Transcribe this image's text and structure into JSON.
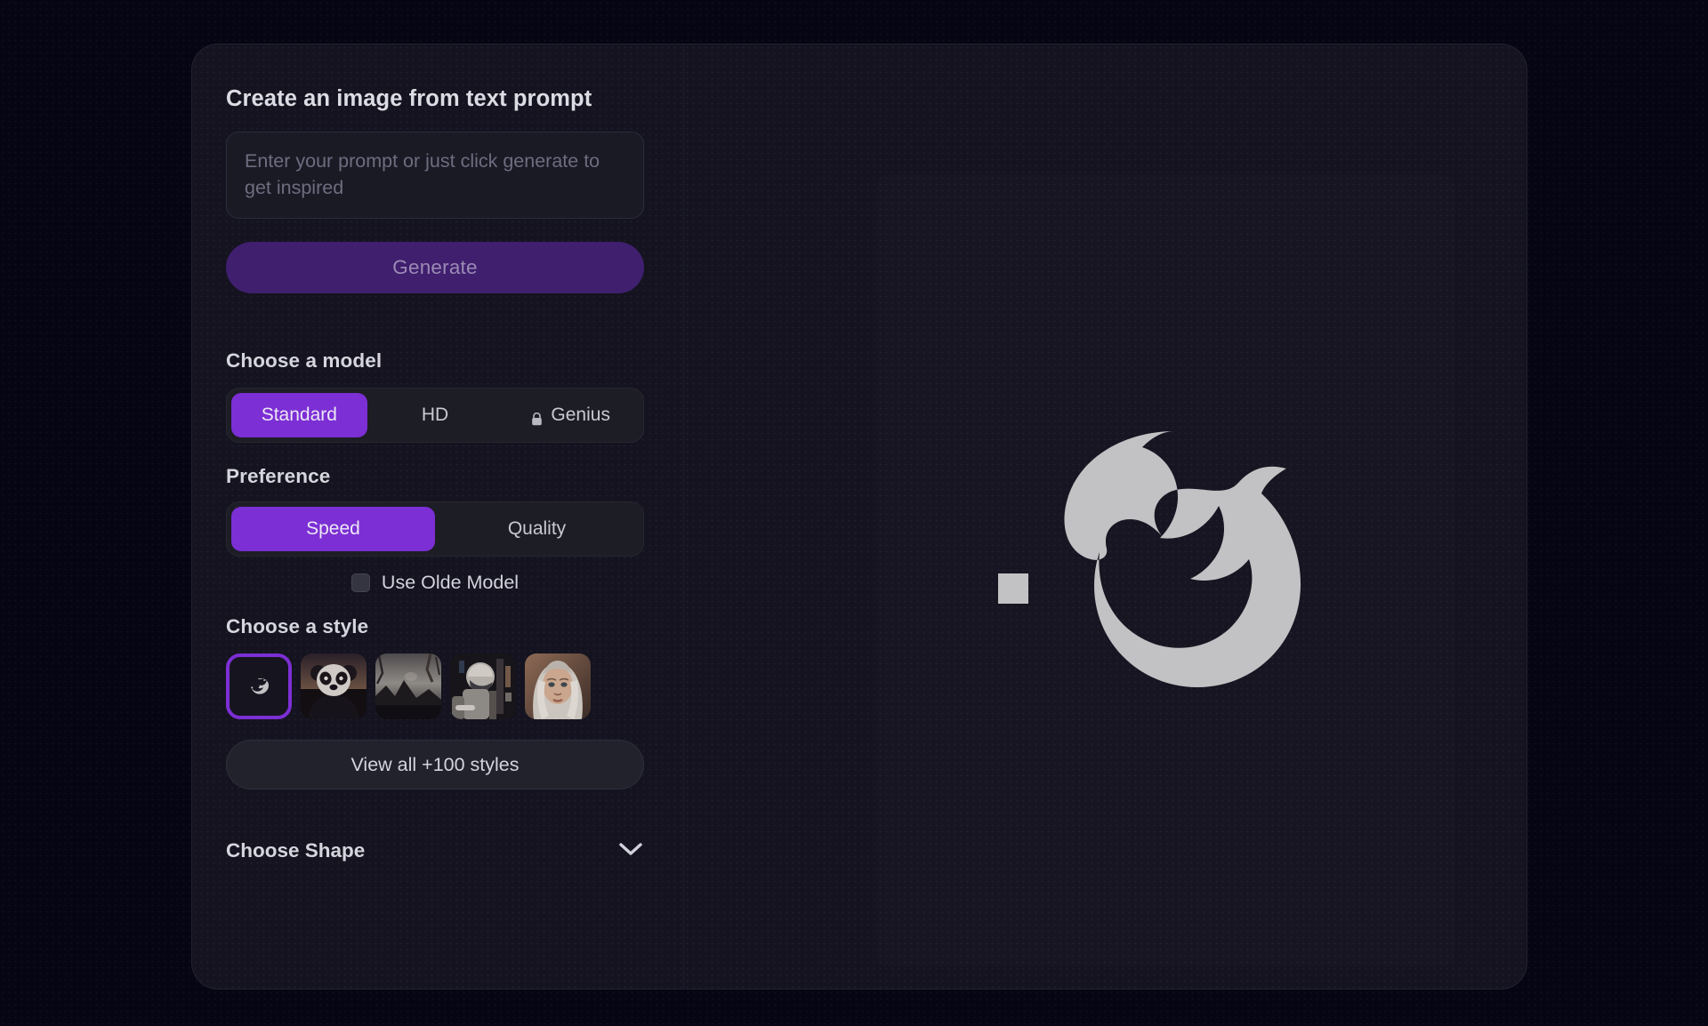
{
  "page": {
    "background_color": "#060513",
    "card_background": "#14131f",
    "accent_color": "#7c2fd4",
    "accent_muted": "#3f1f6e"
  },
  "panel": {
    "title": "Create an image from text prompt",
    "prompt": {
      "value": "",
      "placeholder": "Enter your prompt or just click generate to get inspired"
    },
    "generate_label": "Generate",
    "model": {
      "label": "Choose a model",
      "options": [
        {
          "label": "Standard",
          "selected": true,
          "locked": false
        },
        {
          "label": "HD",
          "selected": false,
          "locked": false
        },
        {
          "label": "Genius",
          "selected": false,
          "locked": true,
          "icon": "lock-icon"
        }
      ]
    },
    "preference": {
      "label": "Preference",
      "options": [
        {
          "label": "Speed",
          "selected": true
        },
        {
          "label": "Quality",
          "selected": false
        }
      ]
    },
    "olde_model": {
      "label": "Use Olde Model",
      "checked": false
    },
    "style": {
      "label": "Choose a style",
      "thumbnails": [
        {
          "name": "no-style",
          "selected": true,
          "icon": "dolphin-icon"
        },
        {
          "name": "panda",
          "selected": false
        },
        {
          "name": "landscape",
          "selected": false
        },
        {
          "name": "sci-fi",
          "selected": false
        },
        {
          "name": "portrait",
          "selected": false
        }
      ],
      "view_all_label": "View all +100 styles"
    },
    "shape": {
      "label": "Choose Shape",
      "expanded": false,
      "chevron": "chevron-down-icon"
    }
  },
  "preview": {
    "logo_name": "dolphin-logo",
    "logo_color": "#c2c2c4"
  }
}
